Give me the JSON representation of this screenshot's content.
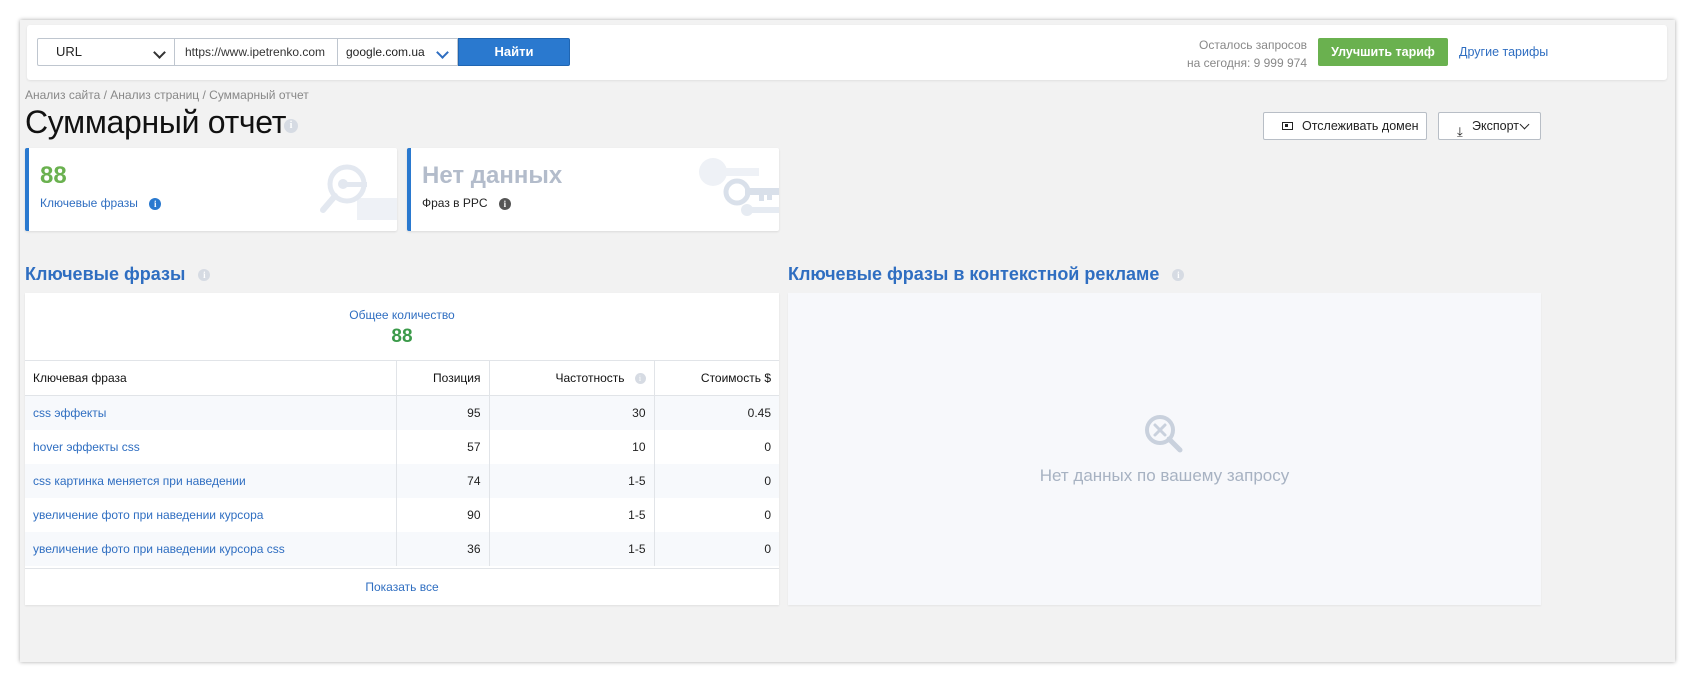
{
  "search": {
    "type": "URL",
    "url_value": "https://www.ipetrenko.com",
    "engine": "google.com.ua",
    "find_label": "Найти"
  },
  "account": {
    "requests_line1": "Осталось запросов",
    "requests_line2": "на сегодня: 9 999 974",
    "upgrade_label": "Улучшить тариф",
    "other_plans_label": "Другие тарифы"
  },
  "breadcrumb": "Анализ сайта / Анализ страниц / Суммарный отчет",
  "page_title": "Суммарный отчет",
  "actions": {
    "track_label": "Отслеживать домен",
    "export_label": "Экспорт"
  },
  "cards": [
    {
      "value": "88",
      "label": "Ключевые фразы",
      "value_color": "#6ab14f",
      "label_color": "#2f6ec1"
    },
    {
      "value": "Нет данных",
      "label": "Фраз в PPC",
      "value_color": "#b3bccb",
      "label_color": "#222222"
    }
  ],
  "keywords_section": {
    "title": "Ключевые фразы",
    "total_label": "Общее количество",
    "total_value": "88",
    "columns": [
      "Ключевая фраза",
      "Позиция",
      "Частотность",
      "Стоимость $"
    ],
    "rows": [
      {
        "phrase": "css эффекты",
        "position": "95",
        "frequency": "30",
        "cost": "0.45"
      },
      {
        "phrase": "hover эффекты css",
        "position": "57",
        "frequency": "10",
        "cost": "0"
      },
      {
        "phrase": "css картинка меняется при наведении",
        "position": "74",
        "frequency": "1-5",
        "cost": "0"
      },
      {
        "phrase": "увеличение фото при наведении курсора",
        "position": "90",
        "frequency": "1-5",
        "cost": "0"
      },
      {
        "phrase": "увеличение фото при наведении курсора css",
        "position": "36",
        "frequency": "1-5",
        "cost": "0"
      }
    ],
    "show_all_label": "Показать все"
  },
  "ppc_section": {
    "title": "Ключевые фразы в контекстной рекламе",
    "empty_text": "Нет данных по вашему запросу"
  },
  "colors": {
    "accent": "#2a79cf",
    "link": "#2f6ec1",
    "success": "#6ab14f",
    "count_green": "#3b9a4a"
  },
  "icons": {
    "title_info": "info-icon",
    "card_keywords": "magnifier-key-icon",
    "card_ppc": "keys-icon",
    "empty": "search-x-icon",
    "export": "download-icon",
    "track": "monitor-icon"
  }
}
